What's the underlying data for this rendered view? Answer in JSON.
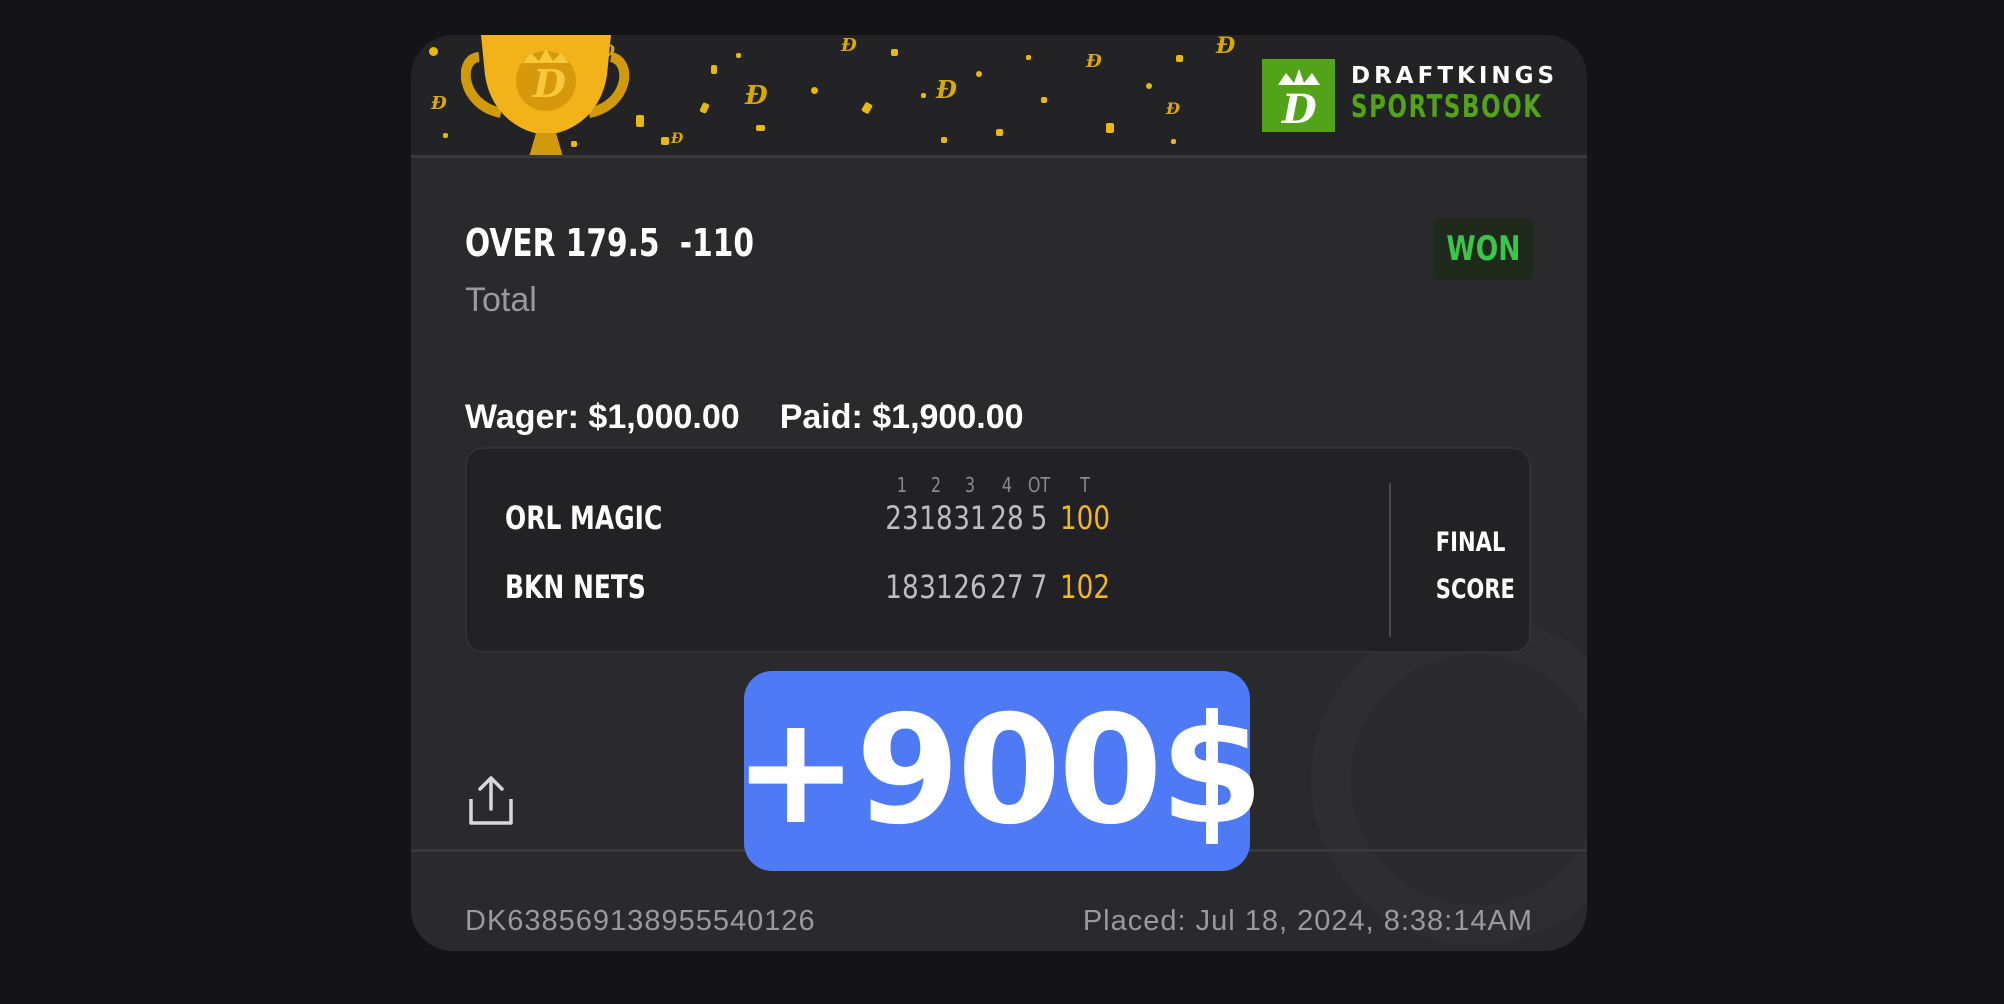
{
  "brand": {
    "line1": "DRAFTKINGS",
    "line2": "SPORTSBOOK",
    "logo_icon": "draftkings-crown-logo",
    "green": "#53a318"
  },
  "bet": {
    "selection": "OVER 179.5",
    "odds": "-110",
    "type": "Total",
    "status": "WON",
    "wager_label": "Wager: $1,000.00",
    "paid_label": "Paid: $1,900.00"
  },
  "scoreboard": {
    "periods": [
      "1",
      "2",
      "3",
      "4",
      "OT",
      "T"
    ],
    "teams": [
      {
        "name": "ORL MAGIC",
        "scores": [
          "23",
          "18",
          "31",
          "28",
          "5"
        ],
        "total": "100"
      },
      {
        "name": "BKN NETS",
        "scores": [
          "18",
          "31",
          "26",
          "27",
          "7"
        ],
        "total": "102"
      }
    ],
    "final_line1": "FINAL",
    "final_line2": "SCORE",
    "total_color": "#f2b524"
  },
  "promo": {
    "text": "+900$",
    "color": "#4e7af6"
  },
  "footer": {
    "bet_id": "DK638569138955540126",
    "placed": "Placed: Jul 18, 2024, 8:38:14AM"
  },
  "icons": {
    "share": "share-icon",
    "trophy": "trophy-icon"
  }
}
